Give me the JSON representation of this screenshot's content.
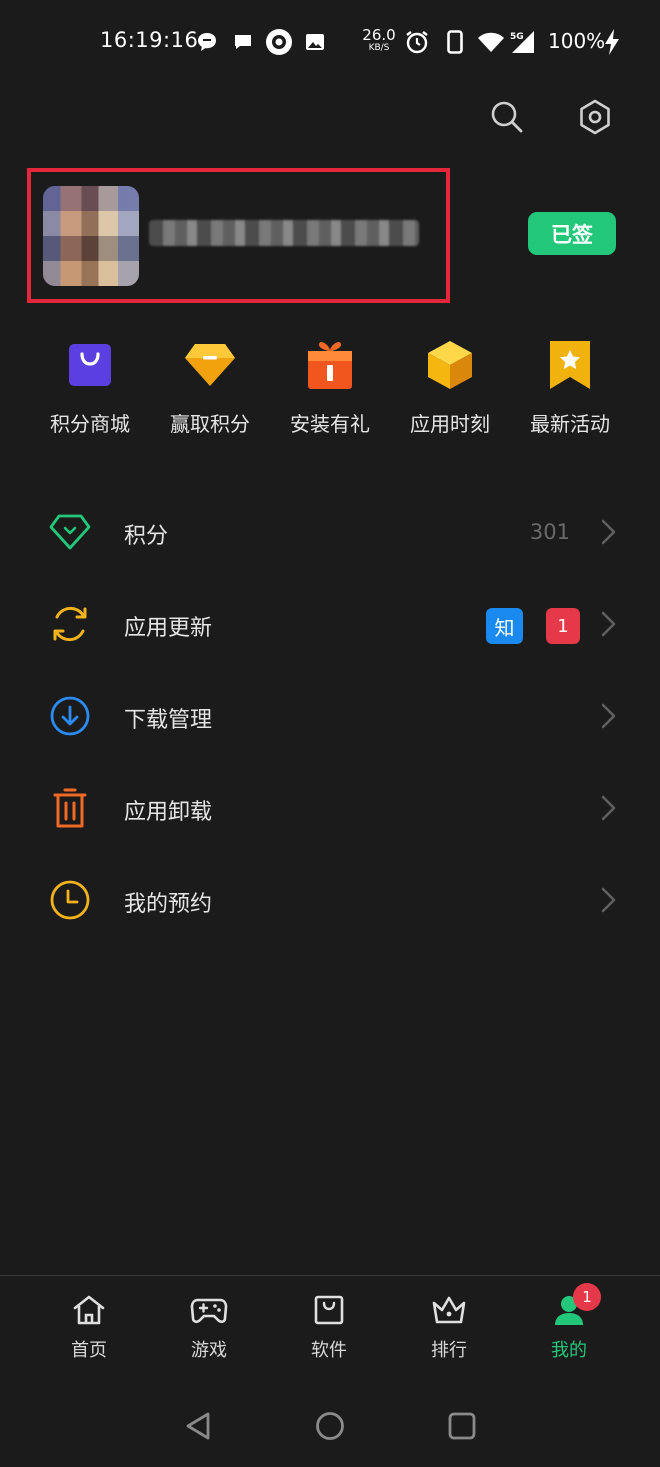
{
  "status_bar": {
    "time": "16:19:16",
    "net_speed_value": "26.0",
    "net_speed_unit": "KB/S",
    "network": "5G",
    "battery": "100%",
    "icons": [
      "chat-bubble-icon",
      "message-icon",
      "app-eye-icon",
      "image-icon",
      "alarm-icon",
      "phone-icon",
      "wifi-icon",
      "signal-5g-icon",
      "charging-icon"
    ]
  },
  "header": {
    "icons": [
      "search-icon",
      "settings-icon"
    ]
  },
  "profile": {
    "username": "",
    "signed_button": "已签"
  },
  "quick_actions": [
    {
      "label": "积分商城",
      "icon": "shopping-bag-icon",
      "color": "#5b3fe0"
    },
    {
      "label": "赢取积分",
      "icon": "diamond-icon",
      "color": "#f2a20c"
    },
    {
      "label": "安装有礼",
      "icon": "gift-icon",
      "color": "#f0561d"
    },
    {
      "label": "应用时刻",
      "icon": "cube-icon",
      "color": "#f5b60f"
    },
    {
      "label": "最新活动",
      "icon": "star-bookmark-icon",
      "color": "#f2b20e"
    }
  ],
  "menu": [
    {
      "label": "积分",
      "value": "301",
      "icon": "gem-icon",
      "color": "#22c77a"
    },
    {
      "label": "应用更新",
      "value": "",
      "icon": "refresh-icon",
      "color": "#f2b21c",
      "badge_zhi": "知",
      "badge_count": "1"
    },
    {
      "label": "下载管理",
      "value": "",
      "icon": "download-icon",
      "color": "#2b8bf0"
    },
    {
      "label": "应用卸载",
      "value": "",
      "icon": "trash-icon",
      "color": "#f06a25"
    },
    {
      "label": "我的预约",
      "value": "",
      "icon": "clock-icon",
      "color": "#f2b21c"
    }
  ],
  "bottom_nav": [
    {
      "label": "首页",
      "icon": "home-icon"
    },
    {
      "label": "游戏",
      "icon": "gamepad-icon"
    },
    {
      "label": "软件",
      "icon": "software-bag-icon"
    },
    {
      "label": "排行",
      "icon": "crown-icon"
    },
    {
      "label": "我的",
      "icon": "user-icon",
      "active": true,
      "badge": "1"
    }
  ],
  "system_nav": [
    "back-icon",
    "home-circle-icon",
    "recents-icon"
  ],
  "colors": {
    "background": "#1b1b1b",
    "accent": "#22c77a",
    "highlight_border": "#e5273b"
  }
}
